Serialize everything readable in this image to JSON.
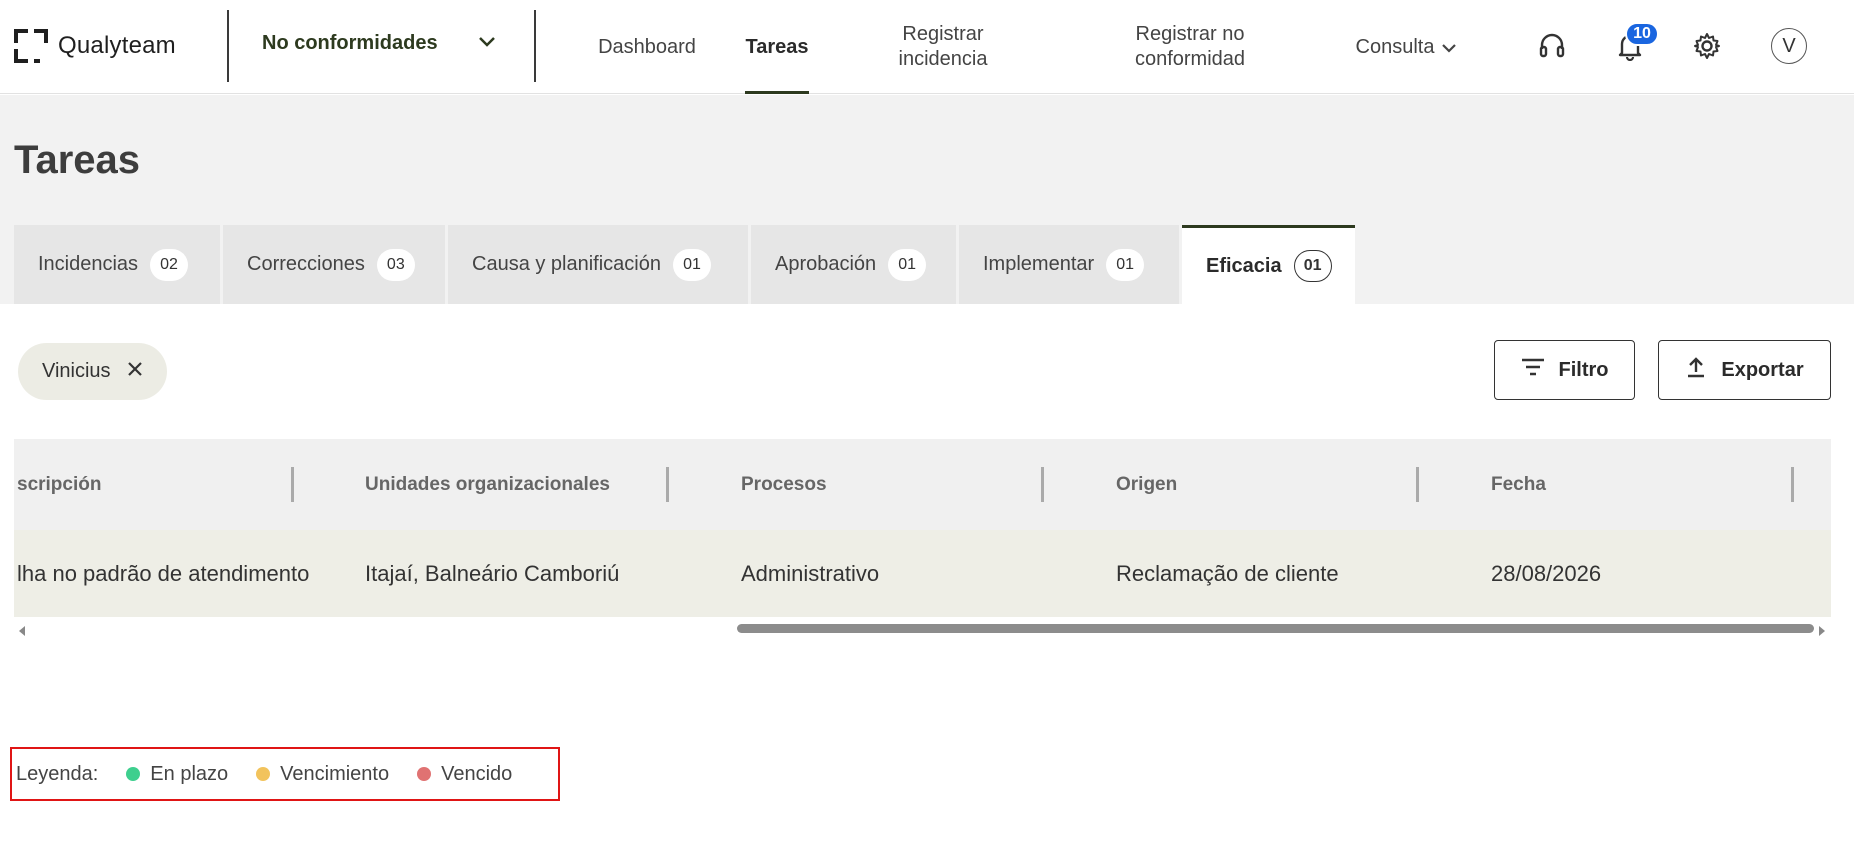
{
  "header": {
    "logo_text": "Qualyteam",
    "module": "No conformidades",
    "nav": [
      "Dashboard",
      "Tareas",
      "Registrar incidencia",
      "Registrar no conformidad",
      "Consulta"
    ],
    "notifications_count": "10",
    "avatar_initial": "V",
    "icons": [
      "headset-icon",
      "bell-icon",
      "gear-icon",
      "chevron-down-icon"
    ]
  },
  "page": {
    "title": "Tareas"
  },
  "tabs": [
    {
      "label": "Incidencias",
      "count": "02"
    },
    {
      "label": "Correcciones",
      "count": "03"
    },
    {
      "label": "Causa y planificación",
      "count": "01"
    },
    {
      "label": "Aprobación",
      "count": "01"
    },
    {
      "label": "Implementar",
      "count": "01"
    },
    {
      "label": "Eficacia",
      "count": "01"
    }
  ],
  "filters": {
    "chip_label": "Vinicius",
    "filter_button": "Filtro",
    "export_button": "Exportar"
  },
  "table": {
    "columns": [
      "scripción",
      "Unidades organizacionales",
      "Procesos",
      "Origen",
      "Fecha"
    ],
    "rows": [
      [
        "lha no padrão de atendimento",
        "Itajaí, Balneário Camboriú",
        "Administrativo",
        "Reclamação de cliente",
        "28/08/2026"
      ]
    ]
  },
  "legend": {
    "title": "Leyenda:",
    "items": [
      {
        "label": "En plazo",
        "color": "#3ecf8e"
      },
      {
        "label": "Vencimiento",
        "color": "#f2c35c"
      },
      {
        "label": "Vencido",
        "color": "#e07272"
      }
    ]
  },
  "colors": {
    "brand_dark": "#2d3a1f",
    "badge": "#1a66e0",
    "legend_border": "#e01515"
  }
}
